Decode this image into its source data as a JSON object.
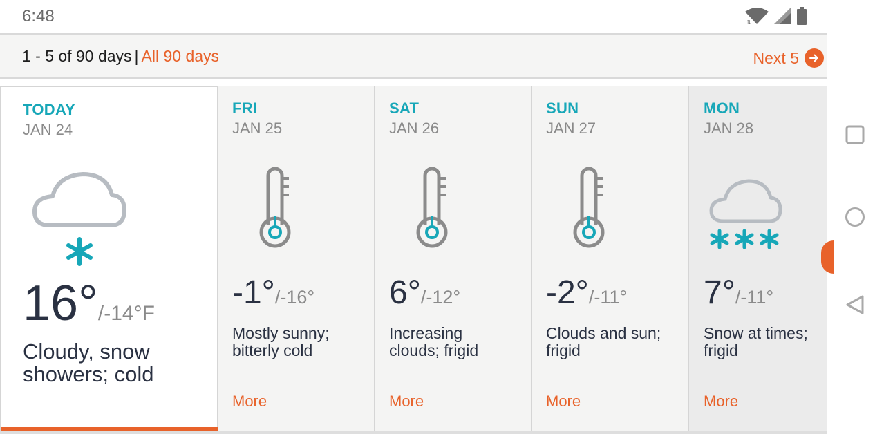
{
  "status_bar": {
    "time": "6:48"
  },
  "range_bar": {
    "range_text": "1 - 5 of 90 days",
    "separator": "|",
    "all_days_label": "All 90 days",
    "next_label": "Next 5"
  },
  "days": [
    {
      "name": "TODAY",
      "date": "JAN 24",
      "icon": "cloud-snow-icon",
      "high": "16°",
      "low": "/-14°F",
      "description_lines": [
        "Cloudy, snow",
        "showers; cold"
      ],
      "more": "More"
    },
    {
      "name": "FRI",
      "date": "JAN 25",
      "icon": "thermometer-cold-icon",
      "high": "-1°",
      "low": "/-16°",
      "description_lines": [
        "Mostly sunny;",
        "bitterly cold"
      ],
      "more": "More"
    },
    {
      "name": "SAT",
      "date": "JAN 26",
      "icon": "thermometer-cold-icon",
      "high": "6°",
      "low": "/-12°",
      "description_lines": [
        "Increasing",
        "clouds; frigid"
      ],
      "more": "More"
    },
    {
      "name": "SUN",
      "date": "JAN 27",
      "icon": "thermometer-cold-icon",
      "high": "-2°",
      "low": "/-11°",
      "description_lines": [
        "Clouds and sun;",
        "frigid"
      ],
      "more": "More"
    },
    {
      "name": "MON",
      "date": "JAN 28",
      "icon": "cloud-heavy-snow-icon",
      "high": "7°",
      "low": "/-11°",
      "description_lines": [
        "Snow at times;",
        "frigid"
      ],
      "more": "More"
    }
  ],
  "colors": {
    "accent": "#e8622a",
    "day_label": "#17a7b8",
    "snow": "#17a7b8",
    "text": "#2a3142",
    "muted": "#8a8a8a"
  },
  "nav_icons": [
    "recents-square-icon",
    "home-circle-icon",
    "back-triangle-icon"
  ]
}
